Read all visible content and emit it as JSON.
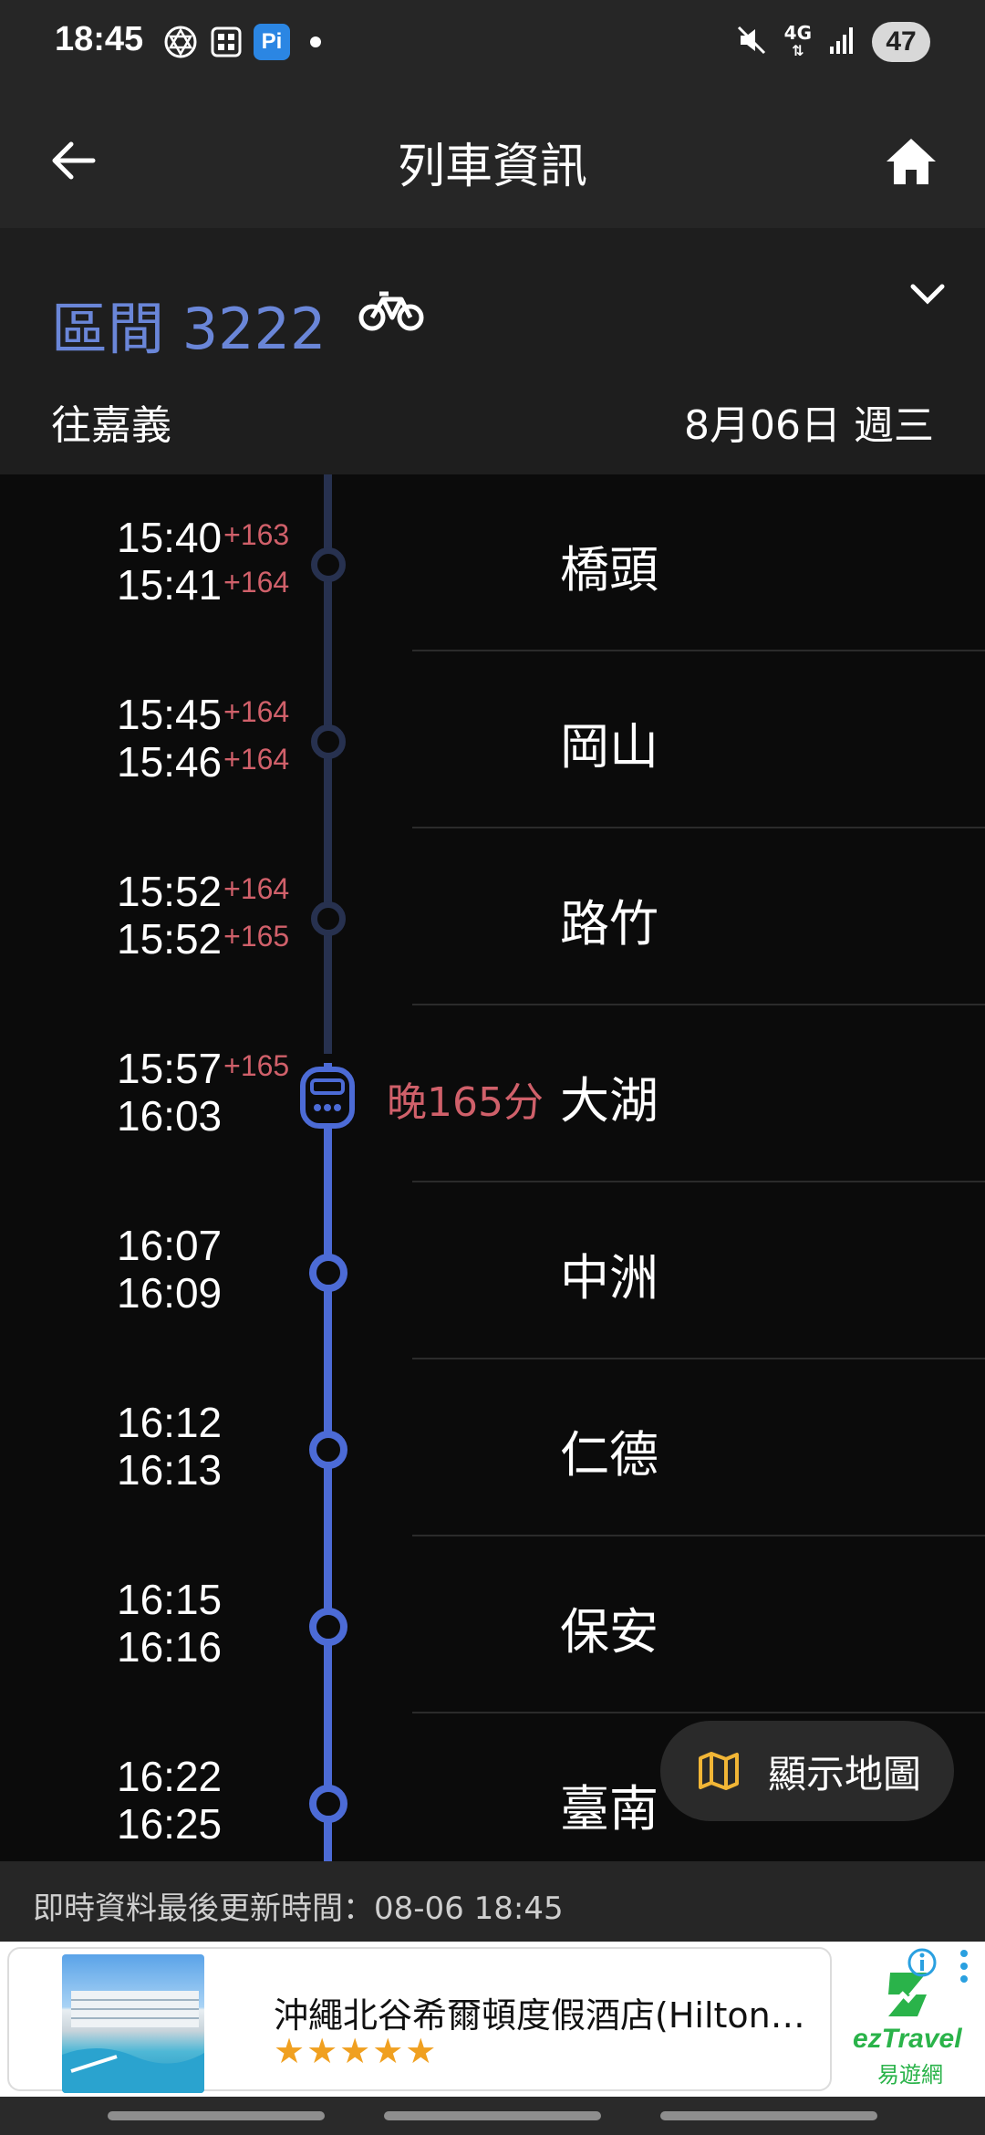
{
  "status_bar": {
    "time": "18:45",
    "network": "4G",
    "battery": "47",
    "icons": [
      "star-of-david-icon",
      "lottery-app-icon",
      "pi-app-icon",
      "notification-dot-icon",
      "mute-icon",
      "network-icon",
      "signal-icon",
      "battery-icon"
    ],
    "pi_label": "Pi"
  },
  "app_bar": {
    "title": "列車資訊",
    "back_icon": "arrow-left-icon",
    "home_icon": "home-icon"
  },
  "train": {
    "name": "區間 3222",
    "bike_icon": "bicycle-icon",
    "direction": "往嘉義",
    "date": "8月06日 週三"
  },
  "stops": [
    {
      "arr": "15:40",
      "arr_delay": "+163",
      "dep": "15:41",
      "dep_delay": "+164",
      "station": "橋頭",
      "passed": true
    },
    {
      "arr": "15:45",
      "arr_delay": "+164",
      "dep": "15:46",
      "dep_delay": "+164",
      "station": "岡山",
      "passed": true
    },
    {
      "arr": "15:52",
      "arr_delay": "+164",
      "dep": "15:52",
      "dep_delay": "+165",
      "station": "路竹",
      "passed": true
    },
    {
      "arr": "15:57",
      "arr_delay": "+165",
      "dep": "16:03",
      "dep_delay": "",
      "station": "大湖",
      "current": true,
      "late_label": "晚165分"
    },
    {
      "arr": "16:07",
      "arr_delay": "",
      "dep": "16:09",
      "dep_delay": "",
      "station": "中洲"
    },
    {
      "arr": "16:12",
      "arr_delay": "",
      "dep": "16:13",
      "dep_delay": "",
      "station": "仁德"
    },
    {
      "arr": "16:15",
      "arr_delay": "",
      "dep": "16:16",
      "dep_delay": "",
      "station": "保安"
    },
    {
      "arr": "16:22",
      "arr_delay": "",
      "dep": "16:25",
      "dep_delay": "",
      "station": "臺南"
    }
  ],
  "map_button": {
    "label": "顯示地圖",
    "icon": "map-icon"
  },
  "update_text": "即時資料最後更新時間：08-06 18:45",
  "ad": {
    "title": "沖繩北谷希爾頓度假酒店(Hilton…",
    "stars": "★★★★★",
    "brand": "ezTravel",
    "brand_sub": "易遊網"
  },
  "colors": {
    "accent": "#6a86d8",
    "delay": "#d0606a",
    "track_active": "#4c6bd6",
    "track_passed": "#27314f"
  }
}
